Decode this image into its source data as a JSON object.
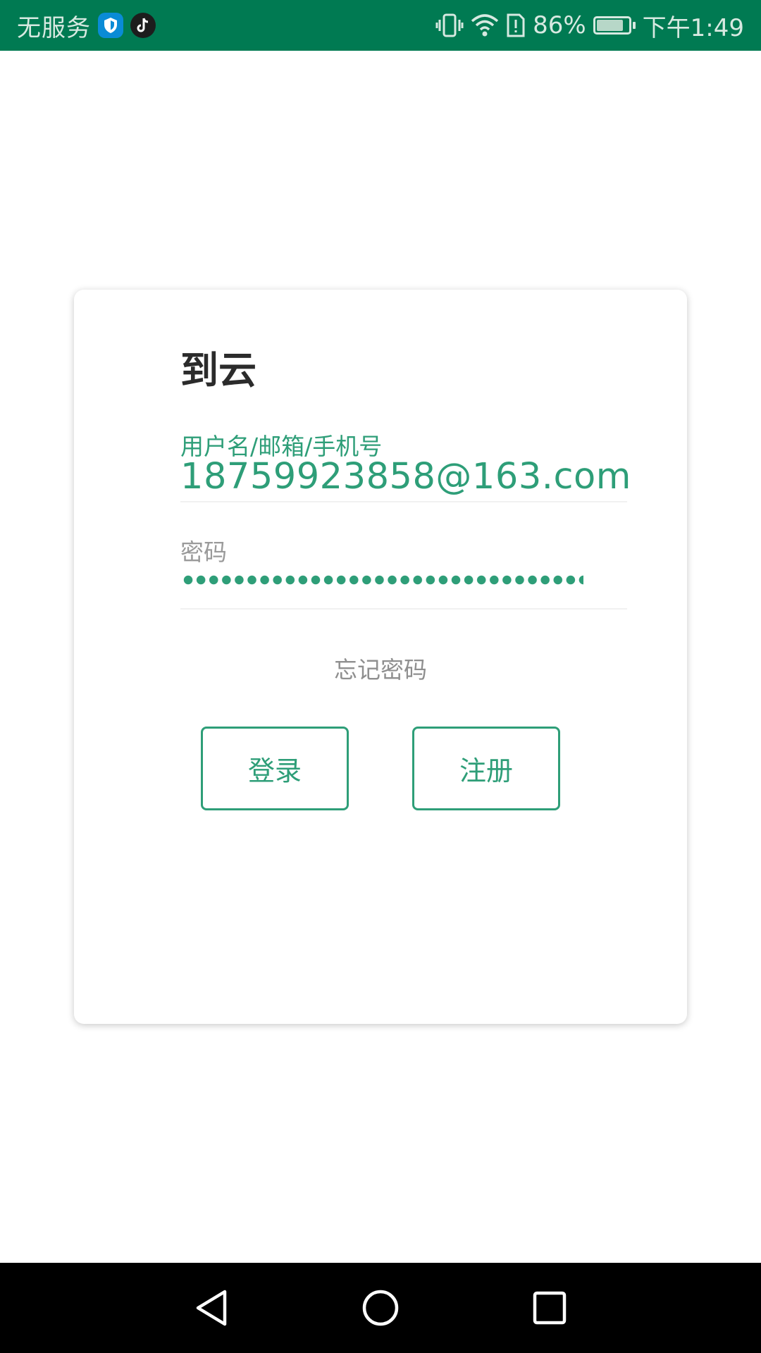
{
  "status_bar": {
    "carrier": "无服务",
    "battery_percent": "86%",
    "battery_level": 0.86,
    "time": "下午1:49",
    "icons": [
      "shield-app-icon",
      "tiktok-app-icon",
      "vibrate-icon",
      "wifi-icon",
      "sim-alert-icon",
      "battery-icon"
    ]
  },
  "login": {
    "title": "到云",
    "username_label": "用户名/邮箱/手机号",
    "username_value": "18759923858@163.com",
    "password_label": "密码",
    "forgot_password": "忘记密码",
    "login_button": "登录",
    "register_button": "注册"
  },
  "navigation": {
    "icons": [
      "back-icon",
      "home-icon",
      "recents-icon"
    ]
  },
  "colors": {
    "status_bar": "#007a52",
    "accent": "#2e9e78",
    "title_text": "#2b2b2b",
    "muted_text": "#9a9a9a",
    "nav_bar": "#000000"
  }
}
